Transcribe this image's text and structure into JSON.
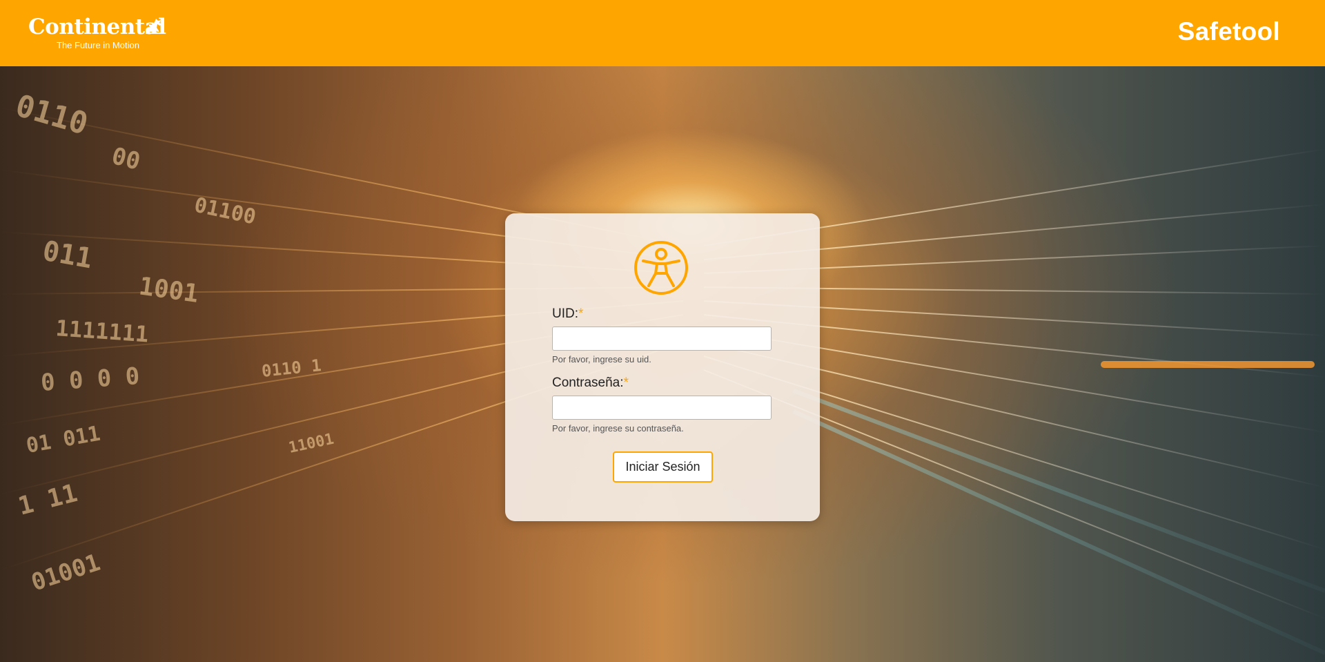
{
  "header": {
    "logo_text": "Continental",
    "logo_tagline": "The Future in Motion",
    "app_title": "Safetool",
    "background_color": "#ffa500"
  },
  "login": {
    "icon": "person-circle-icon",
    "uid_label": "UID:",
    "uid_required_mark": "*",
    "uid_value": "",
    "uid_hint": "Por favor, ingrese su uid.",
    "password_label": "Contraseña:",
    "password_required_mark": "*",
    "password_value": "",
    "password_hint": "Por favor, ingrese su contraseña.",
    "submit_label": "Iniciar Sesión",
    "accent_color": "#ffa500"
  }
}
